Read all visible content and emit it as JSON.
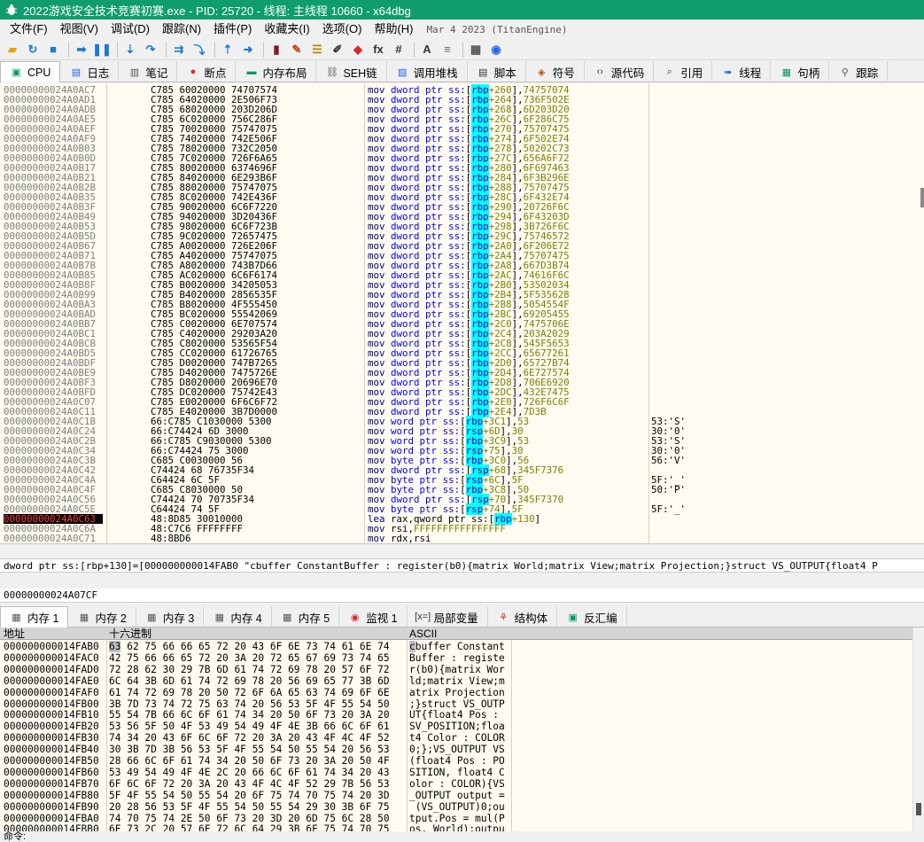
{
  "window": {
    "title": "2022游戏安全技术竞赛初赛.exe - PID: 25720 - 线程: 主线程 10660 - x64dbg"
  },
  "menu": {
    "items": [
      "文件(F)",
      "视图(V)",
      "调试(D)",
      "跟踪(N)",
      "插件(P)",
      "收藏夹(I)",
      "选项(O)",
      "帮助(H)"
    ],
    "build_date": "Mar 4 2023 (TitanEngine)"
  },
  "toolbar": {
    "icons": [
      {
        "name": "open-icon",
        "glyph": "▰",
        "color": "#e8a000"
      },
      {
        "name": "restart-icon",
        "glyph": "↻",
        "color": "#1a7ad4"
      },
      {
        "name": "stop-icon",
        "glyph": "■",
        "color": "#1a7ad4"
      },
      {
        "sep": true
      },
      {
        "name": "run-icon",
        "glyph": "➡",
        "color": "#1a7ad4"
      },
      {
        "name": "pause-icon",
        "glyph": "❚❚",
        "color": "#1a7ad4"
      },
      {
        "sep": true
      },
      {
        "name": "step-into-icon",
        "glyph": "⇣",
        "color": "#1a7ad4"
      },
      {
        "name": "step-over-icon",
        "glyph": "↷",
        "color": "#1a7ad4"
      },
      {
        "sep": true
      },
      {
        "name": "trace-into-icon",
        "glyph": "⇉",
        "color": "#1a7ad4"
      },
      {
        "name": "trace-over-icon",
        "glyph": "⤵",
        "color": "#1a7ad4"
      },
      {
        "sep": true
      },
      {
        "name": "execute-till-return-icon",
        "glyph": "⇡",
        "color": "#1a7ad4"
      },
      {
        "name": "run-to-user-code-icon",
        "glyph": "➜",
        "color": "#1a7ad4"
      },
      {
        "sep": true
      },
      {
        "name": "scylla-icon",
        "glyph": "▮",
        "color": "#7a1e1e"
      },
      {
        "name": "patch-icon",
        "glyph": "✎",
        "color": "#c2410c"
      },
      {
        "name": "comment-icon",
        "glyph": "☰",
        "color": "#b58900"
      },
      {
        "name": "label-icon",
        "glyph": "✐",
        "color": "#333"
      },
      {
        "name": "bookmark-icon",
        "glyph": "◆",
        "color": "#dc2626"
      },
      {
        "name": "function-icon",
        "glyph": "fx",
        "color": "#333"
      },
      {
        "name": "hash-icon",
        "glyph": "#",
        "color": "#333"
      },
      {
        "sep": true
      },
      {
        "name": "font-icon",
        "glyph": "A",
        "color": "#333"
      },
      {
        "name": "strings-icon",
        "glyph": "≡",
        "color": "#666"
      },
      {
        "sep": true
      },
      {
        "name": "calculator-icon",
        "glyph": "▦",
        "color": "#555"
      },
      {
        "name": "globe-icon",
        "glyph": "◉",
        "color": "#2563eb"
      }
    ]
  },
  "tabs_top": [
    {
      "name": "tab-cpu",
      "label": "CPU",
      "icon": "cpu-icon",
      "glyph": "▣",
      "color": "#059669",
      "active": true
    },
    {
      "name": "tab-log",
      "label": "日志",
      "icon": "log-icon",
      "glyph": "▤",
      "color": "#2563eb"
    },
    {
      "name": "tab-notes",
      "label": "笔记",
      "icon": "notes-icon",
      "glyph": "▥",
      "color": "#555"
    },
    {
      "name": "tab-breakpoints",
      "label": "断点",
      "icon": "breakpoint-icon",
      "glyph": "●",
      "color": "#dc2626"
    },
    {
      "name": "tab-memory-map",
      "label": "内存布局",
      "icon": "memory-map-icon",
      "glyph": "▬",
      "color": "#059669"
    },
    {
      "name": "tab-seh",
      "label": "SEH链",
      "icon": "seh-icon",
      "glyph": "⛓",
      "color": "#555"
    },
    {
      "name": "tab-callstack",
      "label": "调用堆栈",
      "icon": "callstack-icon",
      "glyph": "▧",
      "color": "#2563eb"
    },
    {
      "name": "tab-script",
      "label": "脚本",
      "icon": "script-icon",
      "glyph": "▤",
      "color": "#333"
    },
    {
      "name": "tab-symbols",
      "label": "符号",
      "icon": "symbols-icon",
      "glyph": "◈",
      "color": "#b45309"
    },
    {
      "name": "tab-source",
      "label": "源代码",
      "icon": "source-icon",
      "glyph": "‹›",
      "color": "#333"
    },
    {
      "name": "tab-references",
      "label": "引用",
      "icon": "references-icon",
      "glyph": "⌕",
      "color": "#333"
    },
    {
      "name": "tab-threads",
      "label": "线程",
      "icon": "threads-icon",
      "glyph": "➠",
      "color": "#2563eb"
    },
    {
      "name": "tab-handles",
      "label": "句柄",
      "icon": "handles-icon",
      "glyph": "▦",
      "color": "#059669"
    },
    {
      "name": "tab-trace",
      "label": "跟踪",
      "icon": "trace-icon",
      "glyph": "⚲",
      "color": "#555"
    }
  ],
  "disasm": [
    {
      "a": "00000000024A0AC7",
      "b": "C785 60020000 74707574",
      "mn": "mov",
      "sz": "dword ptr",
      "seg": "ss:",
      "reg": "rbp",
      "off": "+260",
      "imm": "74757074"
    },
    {
      "a": "00000000024A0AD1",
      "b": "C785 64020000 2E506F73",
      "mn": "mov",
      "sz": "dword ptr",
      "seg": "ss:",
      "reg": "rbp",
      "off": "+264",
      "imm": "736F502E"
    },
    {
      "a": "00000000024A0ADB",
      "b": "C785 68020000 203D206D",
      "mn": "mov",
      "sz": "dword ptr",
      "seg": "ss:",
      "reg": "rbp",
      "off": "+268",
      "imm": "6D203D20"
    },
    {
      "a": "00000000024A0AE5",
      "b": "C785 6C020000 756C286F",
      "mn": "mov",
      "sz": "dword ptr",
      "seg": "ss:",
      "reg": "rbp",
      "off": "+26C",
      "imm": "6F286C75"
    },
    {
      "a": "00000000024A0AEF",
      "b": "C785 70020000 75747075",
      "mn": "mov",
      "sz": "dword ptr",
      "seg": "ss:",
      "reg": "rbp",
      "off": "+270",
      "imm": "75707475"
    },
    {
      "a": "00000000024A0AF9",
      "b": "C785 74020000 742E506F",
      "mn": "mov",
      "sz": "dword ptr",
      "seg": "ss:",
      "reg": "rbp",
      "off": "+274",
      "imm": "6F502E74"
    },
    {
      "a": "00000000024A0B03",
      "b": "C785 78020000 732C2050",
      "mn": "mov",
      "sz": "dword ptr",
      "seg": "ss:",
      "reg": "rbp",
      "off": "+278",
      "imm": "50202C73"
    },
    {
      "a": "00000000024A0B0D",
      "b": "C785 7C020000 726F6A65",
      "mn": "mov",
      "sz": "dword ptr",
      "seg": "ss:",
      "reg": "rbp",
      "off": "+27C",
      "imm": "656A6F72"
    },
    {
      "a": "00000000024A0B17",
      "b": "C785 80020000 6374696F",
      "mn": "mov",
      "sz": "dword ptr",
      "seg": "ss:",
      "reg": "rbp",
      "off": "+280",
      "imm": "6F697463"
    },
    {
      "a": "00000000024A0B21",
      "b": "C785 84020000 6E293B6F",
      "mn": "mov",
      "sz": "dword ptr",
      "seg": "ss:",
      "reg": "rbp",
      "off": "+284",
      "imm": "6F3B296E"
    },
    {
      "a": "00000000024A0B2B",
      "b": "C785 88020000 75747075",
      "mn": "mov",
      "sz": "dword ptr",
      "seg": "ss:",
      "reg": "rbp",
      "off": "+288",
      "imm": "75707475"
    },
    {
      "a": "00000000024A0B35",
      "b": "C785 8C020000 742E436F",
      "mn": "mov",
      "sz": "dword ptr",
      "seg": "ss:",
      "reg": "rbp",
      "off": "+28C",
      "imm": "6F432E74"
    },
    {
      "a": "00000000024A0B3F",
      "b": "C785 90020000 6C6F7220",
      "mn": "mov",
      "sz": "dword ptr",
      "seg": "ss:",
      "reg": "rbp",
      "off": "+290",
      "imm": "20726F6C"
    },
    {
      "a": "00000000024A0B49",
      "b": "C785 94020000 3D20436F",
      "mn": "mov",
      "sz": "dword ptr",
      "seg": "ss:",
      "reg": "rbp",
      "off": "+294",
      "imm": "6F43203D"
    },
    {
      "a": "00000000024A0B53",
      "b": "C785 98020000 6C6F723B",
      "mn": "mov",
      "sz": "dword ptr",
      "seg": "ss:",
      "reg": "rbp",
      "off": "+298",
      "imm": "3B726F6C"
    },
    {
      "a": "00000000024A0B5D",
      "b": "C785 9C020000 72657475",
      "mn": "mov",
      "sz": "dword ptr",
      "seg": "ss:",
      "reg": "rbp",
      "off": "+29C",
      "imm": "75746572"
    },
    {
      "a": "00000000024A0B67",
      "b": "C785 A0020000 726E206F",
      "mn": "mov",
      "sz": "dword ptr",
      "seg": "ss:",
      "reg": "rbp",
      "off": "+2A0",
      "imm": "6F206E72"
    },
    {
      "a": "00000000024A0B71",
      "b": "C785 A4020000 75747075",
      "mn": "mov",
      "sz": "dword ptr",
      "seg": "ss:",
      "reg": "rbp",
      "off": "+2A4",
      "imm": "75707475"
    },
    {
      "a": "00000000024A0B7B",
      "b": "C785 A8020000 743B7D66",
      "mn": "mov",
      "sz": "dword ptr",
      "seg": "ss:",
      "reg": "rbp",
      "off": "+2A8",
      "imm": "667D3B74"
    },
    {
      "a": "00000000024A0B85",
      "b": "C785 AC020000 6C6F6174",
      "mn": "mov",
      "sz": "dword ptr",
      "seg": "ss:",
      "reg": "rbp",
      "off": "+2AC",
      "imm": "74616F6C"
    },
    {
      "a": "00000000024A0B8F",
      "b": "C785 B0020000 34205053",
      "mn": "mov",
      "sz": "dword ptr",
      "seg": "ss:",
      "reg": "rbp",
      "off": "+2B0",
      "imm": "53502034"
    },
    {
      "a": "00000000024A0B99",
      "b": "C785 B4020000 2856535F",
      "mn": "mov",
      "sz": "dword ptr",
      "seg": "ss:",
      "reg": "rbp",
      "off": "+2B4",
      "imm": "5F535628"
    },
    {
      "a": "00000000024A0BA3",
      "b": "C785 B8020000 4F555450",
      "mn": "mov",
      "sz": "dword ptr",
      "seg": "ss:",
      "reg": "rbp",
      "off": "+2B8",
      "imm": "5054554F"
    },
    {
      "a": "00000000024A0BAD",
      "b": "C785 BC020000 55542069",
      "mn": "mov",
      "sz": "dword ptr",
      "seg": "ss:",
      "reg": "rbp",
      "off": "+2BC",
      "imm": "69205455"
    },
    {
      "a": "00000000024A0BB7",
      "b": "C785 C0020000 6E707574",
      "mn": "mov",
      "sz": "dword ptr",
      "seg": "ss:",
      "reg": "rbp",
      "off": "+2C0",
      "imm": "7475706E"
    },
    {
      "a": "00000000024A0BC1",
      "b": "C785 C4020000 29203A20",
      "mn": "mov",
      "sz": "dword ptr",
      "seg": "ss:",
      "reg": "rbp",
      "off": "+2C4",
      "imm": "203A2029"
    },
    {
      "a": "00000000024A0BCB",
      "b": "C785 C8020000 53565F54",
      "mn": "mov",
      "sz": "dword ptr",
      "seg": "ss:",
      "reg": "rbp",
      "off": "+2C8",
      "imm": "545F5653"
    },
    {
      "a": "00000000024A0BD5",
      "b": "C785 CC020000 61726765",
      "mn": "mov",
      "sz": "dword ptr",
      "seg": "ss:",
      "reg": "rbp",
      "off": "+2CC",
      "imm": "65677261"
    },
    {
      "a": "00000000024A0BDF",
      "b": "C785 D0020000 747B7265",
      "mn": "mov",
      "sz": "dword ptr",
      "seg": "ss:",
      "reg": "rbp",
      "off": "+2D0",
      "imm": "65727B74"
    },
    {
      "a": "00000000024A0BE9",
      "b": "C785 D4020000 7475726E",
      "mn": "mov",
      "sz": "dword ptr",
      "seg": "ss:",
      "reg": "rbp",
      "off": "+2D4",
      "imm": "6E727574"
    },
    {
      "a": "00000000024A0BF3",
      "b": "C785 D8020000 20696E70",
      "mn": "mov",
      "sz": "dword ptr",
      "seg": "ss:",
      "reg": "rbp",
      "off": "+2D8",
      "imm": "706E6920"
    },
    {
      "a": "00000000024A0BFD",
      "b": "C785 DC020000 75742E43",
      "mn": "mov",
      "sz": "dword ptr",
      "seg": "ss:",
      "reg": "rbp",
      "off": "+2DC",
      "imm": "432E7475"
    },
    {
      "a": "00000000024A0C07",
      "b": "C785 E0020000 6F6C6F72",
      "mn": "mov",
      "sz": "dword ptr",
      "seg": "ss:",
      "reg": "rbp",
      "off": "+2E0",
      "imm": "726F6C6F"
    },
    {
      "a": "00000000024A0C11",
      "b": "C785 E4020000 3B7D0000",
      "mn": "mov",
      "sz": "dword ptr",
      "seg": "ss:",
      "reg": "rbp",
      "off": "+2E4",
      "imm": "7D3B"
    },
    {
      "a": "00000000024A0C1B",
      "b": "66:C785 C1030000 5300",
      "mn": "mov",
      "sz": "word ptr",
      "seg": "ss:",
      "reg": "rbp",
      "off": "+3C1",
      "imm": "53",
      "c": "53:'S'"
    },
    {
      "a": "00000000024A0C24",
      "b": "66:C74424 6D 3000",
      "mn": "mov",
      "sz": "word ptr",
      "seg": "ss:",
      "reg": "rsp",
      "off": "+6D",
      "imm": "30",
      "c": "30:'0'"
    },
    {
      "a": "00000000024A0C2B",
      "b": "66:C785 C9030000 5300",
      "mn": "mov",
      "sz": "word ptr",
      "seg": "ss:",
      "reg": "rbp",
      "off": "+3C9",
      "imm": "53",
      "c": "53:'S'"
    },
    {
      "a": "00000000024A0C34",
      "b": "66:C74424 75 3000",
      "mn": "mov",
      "sz": "word ptr",
      "seg": "ss:",
      "reg": "rsp",
      "off": "+75",
      "imm": "30",
      "c": "30:'0'"
    },
    {
      "a": "00000000024A0C3B",
      "b": "C685 C0030000 56",
      "mn": "mov",
      "sz": "byte ptr",
      "seg": "ss:",
      "reg": "rbp",
      "off": "+3C0",
      "imm": "56",
      "c": "56:'V'"
    },
    {
      "a": "00000000024A0C42",
      "b": "C74424 68 76735F34",
      "mn": "mov",
      "sz": "dword ptr",
      "seg": "ss:",
      "reg": "rsp",
      "off": "+68",
      "imm": "345F7376"
    },
    {
      "a": "00000000024A0C4A",
      "b": "C64424 6C 5F",
      "mn": "mov",
      "sz": "byte ptr",
      "seg": "ss:",
      "reg": "rsp",
      "off": "+6C",
      "imm": "5F",
      "c": "5F:'_'"
    },
    {
      "a": "00000000024A0C4F",
      "b": "C685 C8030000 50",
      "mn": "mov",
      "sz": "byte ptr",
      "seg": "ss:",
      "reg": "rbp",
      "off": "+3C8",
      "imm": "50",
      "c": "50:'P'"
    },
    {
      "a": "00000000024A0C56",
      "b": "C74424 70 70735F34",
      "mn": "mov",
      "sz": "dword ptr",
      "seg": "ss:",
      "reg": "rsp",
      "off": "+70",
      "imm": "345F7370"
    },
    {
      "a": "00000000024A0C5E",
      "b": "C64424 74 5F",
      "mn": "mov",
      "sz": "byte ptr",
      "seg": "ss:",
      "reg": "rsp",
      "off": "+74",
      "imm": "5F",
      "c": "5F:'_'"
    },
    {
      "a": "00000000024A0C63",
      "b": "48:8D85 30010000",
      "mn": "lea",
      "raw": "rax,qword ptr ss:",
      "reg": "rbp",
      "off": "+130",
      "sel": true
    },
    {
      "a": "00000000024A0C6A",
      "b": "48:C7C6 FFFFFFFF",
      "mn": "mov",
      "raw": "rsi,",
      "imm2": "FFFFFFFFFFFFFFFF"
    },
    {
      "a": "00000000024A0C71",
      "b": "48:8BD6",
      "mn": "mov",
      "raw": "rdx,rsi"
    }
  ],
  "info": {
    "line1": "dword ptr ss:[rbp+130]=[000000000014FAB0 \"cbuffer ConstantBuffer : register(b0){matrix World;matrix View;matrix Projection;}struct VS_OUTPUT{float4 P",
    "line2": "00000000024A07CF"
  },
  "tabs_bottom": [
    {
      "name": "tab-dump-1",
      "label": "内存 1",
      "icon": "dump-icon",
      "glyph": "▦",
      "color": "#555",
      "active": true
    },
    {
      "name": "tab-dump-2",
      "label": "内存 2",
      "icon": "dump-icon",
      "glyph": "▦",
      "color": "#555"
    },
    {
      "name": "tab-dump-3",
      "label": "内存 3",
      "icon": "dump-icon",
      "glyph": "▦",
      "color": "#555"
    },
    {
      "name": "tab-dump-4",
      "label": "内存 4",
      "icon": "dump-icon",
      "glyph": "▦",
      "color": "#555"
    },
    {
      "name": "tab-dump-5",
      "label": "内存 5",
      "icon": "dump-icon",
      "glyph": "▦",
      "color": "#555"
    },
    {
      "name": "tab-watch",
      "label": "监视 1",
      "icon": "watch-icon",
      "glyph": "◉",
      "color": "#dc2626"
    },
    {
      "name": "tab-locals",
      "label": "局部变量",
      "icon": "locals-icon",
      "glyph": "[x=]",
      "color": "#333"
    },
    {
      "name": "tab-struct",
      "label": "结构体",
      "icon": "struct-icon",
      "glyph": "⚘",
      "color": "#dc2626"
    },
    {
      "name": "tab-disasm",
      "label": "反汇编",
      "icon": "disasm-icon",
      "glyph": "▣",
      "color": "#059669"
    }
  ],
  "hex": {
    "headers": {
      "addr": "地址",
      "hex": "十六进制",
      "ascii": "ASCII"
    },
    "rows": [
      {
        "a": "000000000014FAB0",
        "h": "63 62 75 66 66 65 72 20 43 6F 6E 73 74 61 6E 74",
        "s": "cbuffer Constant"
      },
      {
        "a": "000000000014FAC0",
        "h": "42 75 66 66 65 72 20 3A 20 72 65 67 69 73 74 65",
        "s": "Buffer : registe"
      },
      {
        "a": "000000000014FAD0",
        "h": "72 28 62 30 29 7B 6D 61 74 72 69 78 20 57 6F 72",
        "s": "r(b0){matrix Wor"
      },
      {
        "a": "000000000014FAE0",
        "h": "6C 64 3B 6D 61 74 72 69 78 20 56 69 65 77 3B 6D",
        "s": "ld;matrix View;m"
      },
      {
        "a": "000000000014FAF0",
        "h": "61 74 72 69 78 20 50 72 6F 6A 65 63 74 69 6F 6E",
        "s": "atrix Projection"
      },
      {
        "a": "000000000014FB00",
        "h": "3B 7D 73 74 72 75 63 74 20 56 53 5F 4F 55 54 50",
        "s": ";}struct VS_OUTP"
      },
      {
        "a": "000000000014FB10",
        "h": "55 54 7B 66 6C 6F 61 74 34 20 50 6F 73 20 3A 20",
        "s": "UT{float4 Pos : "
      },
      {
        "a": "000000000014FB20",
        "h": "53 56 5F 50 4F 53 49 54 49 4F 4E 3B 66 6C 6F 61",
        "s": "SV_POSITION;floa"
      },
      {
        "a": "000000000014FB30",
        "h": "74 34 20 43 6F 6C 6F 72 20 3A 20 43 4F 4C 4F 52",
        "s": "t4 Color : COLOR"
      },
      {
        "a": "000000000014FB40",
        "h": "30 3B 7D 3B 56 53 5F 4F 55 54 50 55 54 20 56 53",
        "s": "0;};VS_OUTPUT VS"
      },
      {
        "a": "000000000014FB50",
        "h": "28 66 6C 6F 61 74 34 20 50 6F 73 20 3A 20 50 4F",
        "s": "(float4 Pos : PO"
      },
      {
        "a": "000000000014FB60",
        "h": "53 49 54 49 4F 4E 2C 20 66 6C 6F 61 74 34 20 43",
        "s": "SITION, float4 C"
      },
      {
        "a": "000000000014FB70",
        "h": "6F 6C 6F 72 20 3A 20 43 4F 4C 4F 52 29 7B 56 53",
        "s": "olor : COLOR){VS"
      },
      {
        "a": "000000000014FB80",
        "h": "5F 4F 55 54 50 55 54 20 6F 75 74 70 75 74 20 3D",
        "s": "_OUTPUT output ="
      },
      {
        "a": "000000000014FB90",
        "h": "20 28 56 53 5F 4F 55 54 50 55 54 29 30 3B 6F 75",
        "s": " (VS_OUTPUT)0;ou"
      },
      {
        "a": "000000000014FBA0",
        "h": "74 70 75 74 2E 50 6F 73 20 3D 20 6D 75 6C 28 50",
        "s": "tput.Pos = mul(P"
      },
      {
        "a": "000000000014FBB0",
        "h": "6F 73 2C 20 57 6F 72 6C 64 29 3B 6F 75 74 70 75",
        "s": "os, World);outpu"
      }
    ]
  },
  "status": {
    "text": "命令:"
  }
}
